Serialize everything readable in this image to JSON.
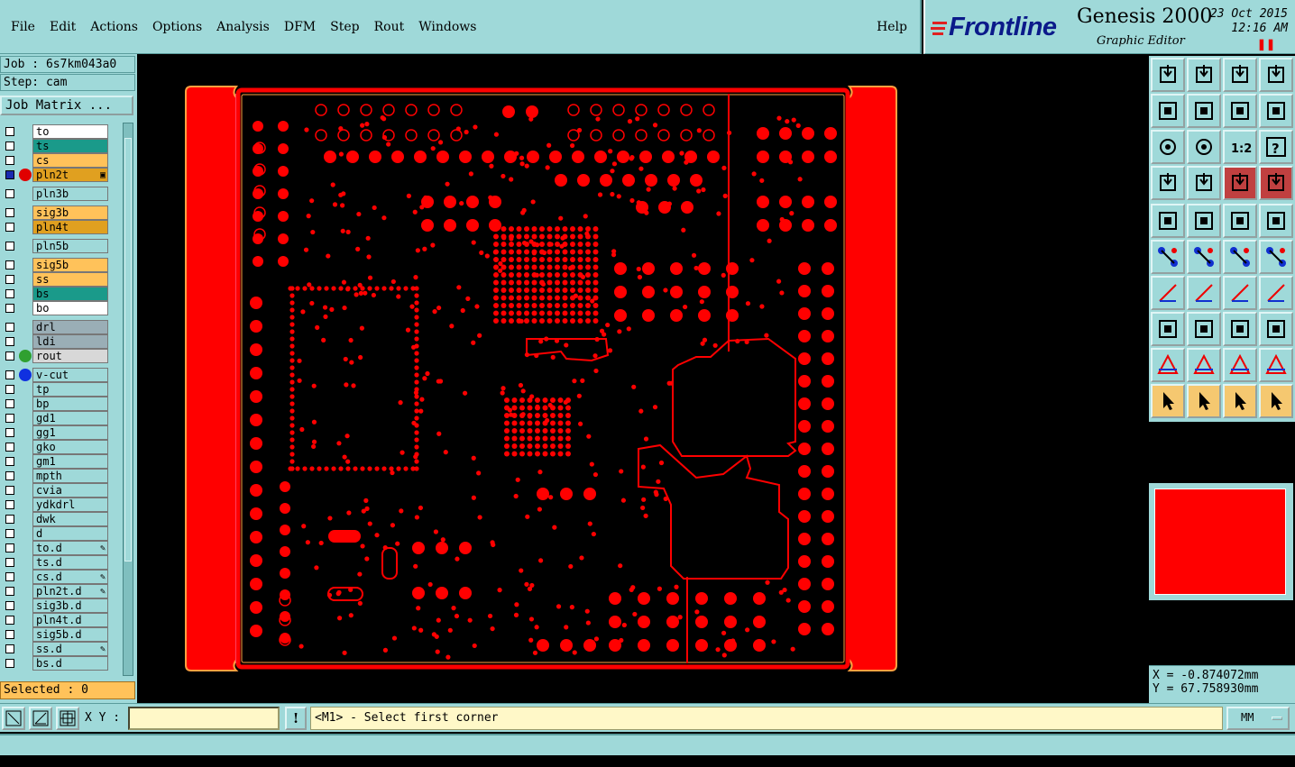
{
  "menu": {
    "items": [
      "File",
      "Edit",
      "Actions",
      "Options",
      "Analysis",
      "DFM",
      "Step",
      "Rout",
      "Windows"
    ],
    "help": "Help"
  },
  "brand": {
    "logo": "Frontline",
    "product": "Genesis 2000",
    "subtitle": "Graphic Editor",
    "date": "23 Oct 2015",
    "time": "12:16 AM",
    "pause_glyph": "❚❚"
  },
  "job": {
    "job_line": "Job : 6s7km043a0",
    "step_line": "Step: cam",
    "matrix_button": "Job Matrix ..."
  },
  "layers": [
    {
      "name": "to",
      "bg": "#ffffff"
    },
    {
      "name": "ts",
      "bg": "#1a9a8a"
    },
    {
      "name": "cs",
      "bg": "#ffc25a"
    },
    {
      "name": "pln2t",
      "bg": "#e0a020",
      "dot": "#e00000",
      "active": true,
      "mark": "▣"
    },
    {
      "name": "pln3b",
      "bg": "#9fd9d9",
      "gap": true
    },
    {
      "name": "sig3b",
      "bg": "#ffc25a",
      "gap": true
    },
    {
      "name": "pln4t",
      "bg": "#e0a020"
    },
    {
      "name": "pln5b",
      "bg": "#9fd9d9",
      "gap": true
    },
    {
      "name": "sig5b",
      "bg": "#ffc25a",
      "gap": true
    },
    {
      "name": "ss",
      "bg": "#ffc25a"
    },
    {
      "name": "bs",
      "bg": "#1a9a8a"
    },
    {
      "name": "bo",
      "bg": "#ffffff"
    },
    {
      "name": "drl",
      "bg": "#9aaeb6",
      "gap": true
    },
    {
      "name": "ldi",
      "bg": "#9aaeb6"
    },
    {
      "name": "rout",
      "bg": "#d8d8d8",
      "dot": "#30a030"
    },
    {
      "name": "v-cut",
      "bg": "#9fd9d9",
      "dot": "#1030e0",
      "gap": true
    },
    {
      "name": "tp",
      "bg": "#9fd9d9"
    },
    {
      "name": "bp",
      "bg": "#9fd9d9"
    },
    {
      "name": "gd1",
      "bg": "#9fd9d9"
    },
    {
      "name": "gg1",
      "bg": "#9fd9d9"
    },
    {
      "name": "gko",
      "bg": "#9fd9d9"
    },
    {
      "name": "gm1",
      "bg": "#9fd9d9"
    },
    {
      "name": "mpth",
      "bg": "#9fd9d9"
    },
    {
      "name": "cvia",
      "bg": "#9fd9d9"
    },
    {
      "name": "ydkdrl",
      "bg": "#9fd9d9"
    },
    {
      "name": "dwk",
      "bg": "#9fd9d9"
    },
    {
      "name": "d",
      "bg": "#9fd9d9"
    },
    {
      "name": "to.d",
      "bg": "#9fd9d9",
      "mark": "✎"
    },
    {
      "name": "ts.d",
      "bg": "#9fd9d9"
    },
    {
      "name": "cs.d",
      "bg": "#9fd9d9",
      "mark": "✎"
    },
    {
      "name": "pln2t.d",
      "bg": "#9fd9d9",
      "mark": "✎"
    },
    {
      "name": "sig3b.d",
      "bg": "#9fd9d9"
    },
    {
      "name": "pln4t.d",
      "bg": "#9fd9d9"
    },
    {
      "name": "sig5b.d",
      "bg": "#9fd9d9"
    },
    {
      "name": "ss.d",
      "bg": "#9fd9d9",
      "mark": "✎"
    },
    {
      "name": "bs.d",
      "bg": "#9fd9d9"
    }
  ],
  "selected": "Selected : 0",
  "coords": {
    "x": "X = -0.874072mm",
    "y": "Y = 67.758930mm"
  },
  "command": {
    "xy_label": "X Y :",
    "xy_value": "",
    "excl": "!",
    "prompt": "<M1> - Select first corner",
    "units": "MM"
  },
  "tools": [
    "layer-top-icon",
    "layer-save-icon",
    "home-icon",
    "zoom-window-icon",
    "pan-left-icon",
    "pan-right-icon",
    "undo-view-icon",
    "redo-view-icon",
    "zoom-fit-icon",
    "zoom-center-icon",
    "scale-1-2-icon",
    "help-icon",
    "measure-icon",
    "snap-icon",
    "traffic-light-icon",
    "traffic-light-2-icon",
    "feature-info-icon",
    "select-box-icon",
    "ruler-icon",
    "pad-icon",
    "connect-icon",
    "delete-icon",
    "move-icon",
    "copy-icon",
    "line-icon",
    "arc-icon",
    "curve-icon",
    "split-icon",
    "add-pad-icon",
    "line-width-icon",
    "resize-icon",
    "shapes-icon",
    "triangle-1-icon",
    "triangle-2-icon",
    "triangle-3-icon",
    "triangle-4-icon",
    "pointer-icon",
    "pointer-select-icon",
    "pointer-rotate-icon",
    "route-icon"
  ],
  "colors": {
    "board": "#ff0000",
    "panel": "#9fd9d9",
    "rail_edge": "#ff7fbf",
    "outline": "#ffa040"
  }
}
